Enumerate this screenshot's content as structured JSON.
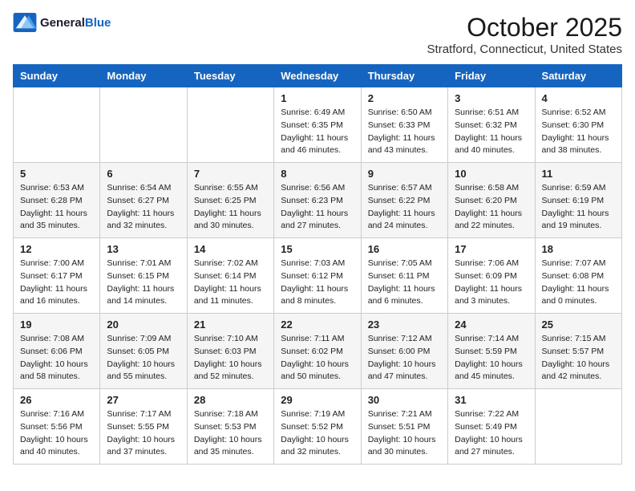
{
  "header": {
    "logo_line1": "General",
    "logo_line2": "Blue",
    "title": "October 2025",
    "subtitle": "Stratford, Connecticut, United States"
  },
  "weekdays": [
    "Sunday",
    "Monday",
    "Tuesday",
    "Wednesday",
    "Thursday",
    "Friday",
    "Saturday"
  ],
  "weeks": [
    [
      {
        "day": "",
        "info": ""
      },
      {
        "day": "",
        "info": ""
      },
      {
        "day": "",
        "info": ""
      },
      {
        "day": "1",
        "info": "Sunrise: 6:49 AM\nSunset: 6:35 PM\nDaylight: 11 hours\nand 46 minutes."
      },
      {
        "day": "2",
        "info": "Sunrise: 6:50 AM\nSunset: 6:33 PM\nDaylight: 11 hours\nand 43 minutes."
      },
      {
        "day": "3",
        "info": "Sunrise: 6:51 AM\nSunset: 6:32 PM\nDaylight: 11 hours\nand 40 minutes."
      },
      {
        "day": "4",
        "info": "Sunrise: 6:52 AM\nSunset: 6:30 PM\nDaylight: 11 hours\nand 38 minutes."
      }
    ],
    [
      {
        "day": "5",
        "info": "Sunrise: 6:53 AM\nSunset: 6:28 PM\nDaylight: 11 hours\nand 35 minutes."
      },
      {
        "day": "6",
        "info": "Sunrise: 6:54 AM\nSunset: 6:27 PM\nDaylight: 11 hours\nand 32 minutes."
      },
      {
        "day": "7",
        "info": "Sunrise: 6:55 AM\nSunset: 6:25 PM\nDaylight: 11 hours\nand 30 minutes."
      },
      {
        "day": "8",
        "info": "Sunrise: 6:56 AM\nSunset: 6:23 PM\nDaylight: 11 hours\nand 27 minutes."
      },
      {
        "day": "9",
        "info": "Sunrise: 6:57 AM\nSunset: 6:22 PM\nDaylight: 11 hours\nand 24 minutes."
      },
      {
        "day": "10",
        "info": "Sunrise: 6:58 AM\nSunset: 6:20 PM\nDaylight: 11 hours\nand 22 minutes."
      },
      {
        "day": "11",
        "info": "Sunrise: 6:59 AM\nSunset: 6:19 PM\nDaylight: 11 hours\nand 19 minutes."
      }
    ],
    [
      {
        "day": "12",
        "info": "Sunrise: 7:00 AM\nSunset: 6:17 PM\nDaylight: 11 hours\nand 16 minutes."
      },
      {
        "day": "13",
        "info": "Sunrise: 7:01 AM\nSunset: 6:15 PM\nDaylight: 11 hours\nand 14 minutes."
      },
      {
        "day": "14",
        "info": "Sunrise: 7:02 AM\nSunset: 6:14 PM\nDaylight: 11 hours\nand 11 minutes."
      },
      {
        "day": "15",
        "info": "Sunrise: 7:03 AM\nSunset: 6:12 PM\nDaylight: 11 hours\nand 8 minutes."
      },
      {
        "day": "16",
        "info": "Sunrise: 7:05 AM\nSunset: 6:11 PM\nDaylight: 11 hours\nand 6 minutes."
      },
      {
        "day": "17",
        "info": "Sunrise: 7:06 AM\nSunset: 6:09 PM\nDaylight: 11 hours\nand 3 minutes."
      },
      {
        "day": "18",
        "info": "Sunrise: 7:07 AM\nSunset: 6:08 PM\nDaylight: 11 hours\nand 0 minutes."
      }
    ],
    [
      {
        "day": "19",
        "info": "Sunrise: 7:08 AM\nSunset: 6:06 PM\nDaylight: 10 hours\nand 58 minutes."
      },
      {
        "day": "20",
        "info": "Sunrise: 7:09 AM\nSunset: 6:05 PM\nDaylight: 10 hours\nand 55 minutes."
      },
      {
        "day": "21",
        "info": "Sunrise: 7:10 AM\nSunset: 6:03 PM\nDaylight: 10 hours\nand 52 minutes."
      },
      {
        "day": "22",
        "info": "Sunrise: 7:11 AM\nSunset: 6:02 PM\nDaylight: 10 hours\nand 50 minutes."
      },
      {
        "day": "23",
        "info": "Sunrise: 7:12 AM\nSunset: 6:00 PM\nDaylight: 10 hours\nand 47 minutes."
      },
      {
        "day": "24",
        "info": "Sunrise: 7:14 AM\nSunset: 5:59 PM\nDaylight: 10 hours\nand 45 minutes."
      },
      {
        "day": "25",
        "info": "Sunrise: 7:15 AM\nSunset: 5:57 PM\nDaylight: 10 hours\nand 42 minutes."
      }
    ],
    [
      {
        "day": "26",
        "info": "Sunrise: 7:16 AM\nSunset: 5:56 PM\nDaylight: 10 hours\nand 40 minutes."
      },
      {
        "day": "27",
        "info": "Sunrise: 7:17 AM\nSunset: 5:55 PM\nDaylight: 10 hours\nand 37 minutes."
      },
      {
        "day": "28",
        "info": "Sunrise: 7:18 AM\nSunset: 5:53 PM\nDaylight: 10 hours\nand 35 minutes."
      },
      {
        "day": "29",
        "info": "Sunrise: 7:19 AM\nSunset: 5:52 PM\nDaylight: 10 hours\nand 32 minutes."
      },
      {
        "day": "30",
        "info": "Sunrise: 7:21 AM\nSunset: 5:51 PM\nDaylight: 10 hours\nand 30 minutes."
      },
      {
        "day": "31",
        "info": "Sunrise: 7:22 AM\nSunset: 5:49 PM\nDaylight: 10 hours\nand 27 minutes."
      },
      {
        "day": "",
        "info": ""
      }
    ]
  ]
}
